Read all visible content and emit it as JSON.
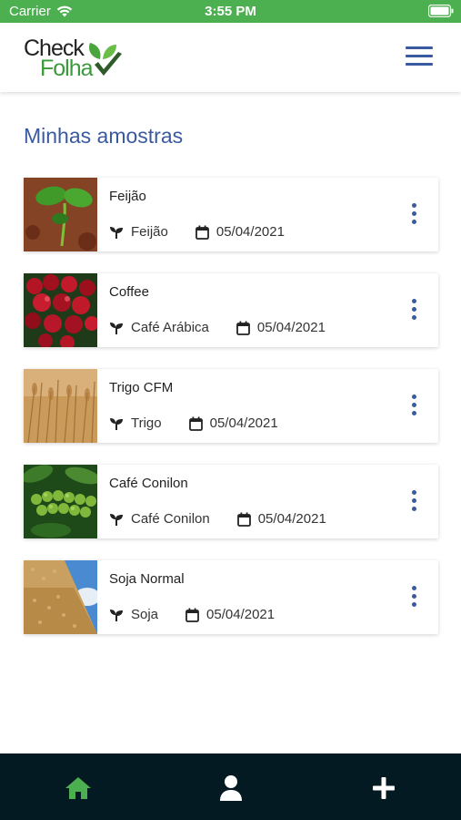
{
  "status_bar": {
    "carrier": "Carrier",
    "time": "3:55 PM"
  },
  "header": {
    "logo_line1": "Check",
    "logo_line2": "Folha",
    "menu_icon": "hamburger-icon"
  },
  "page_title": "Minhas amostras",
  "samples": [
    {
      "title": "Feijão",
      "variety": "Feijão",
      "date": "05/04/2021",
      "thumb": "bean-seedling"
    },
    {
      "title": "Coffee",
      "variety": "Café Arábica",
      "date": "05/04/2021",
      "thumb": "red-coffee-cherries"
    },
    {
      "title": "Trigo CFM",
      "variety": "Trigo",
      "date": "05/04/2021",
      "thumb": "wheat-field"
    },
    {
      "title": "Café Conilon",
      "variety": "Café Conilon",
      "date": "05/04/2021",
      "thumb": "green-coffee-cherries"
    },
    {
      "title": "Soja Normal",
      "variety": "Soja",
      "date": "05/04/2021",
      "thumb": "soybean-pile"
    }
  ],
  "tabbar": {
    "items": [
      {
        "icon": "home-icon",
        "active": true
      },
      {
        "icon": "user-icon",
        "active": false
      },
      {
        "icon": "plus-icon",
        "active": false
      }
    ]
  },
  "colors": {
    "status_bar": "#4CAF50",
    "accent": "#3a5aa0",
    "logo_green": "#3b9a3b",
    "tabbar_bg": "#041a22",
    "tab_active": "#4CAF50"
  }
}
